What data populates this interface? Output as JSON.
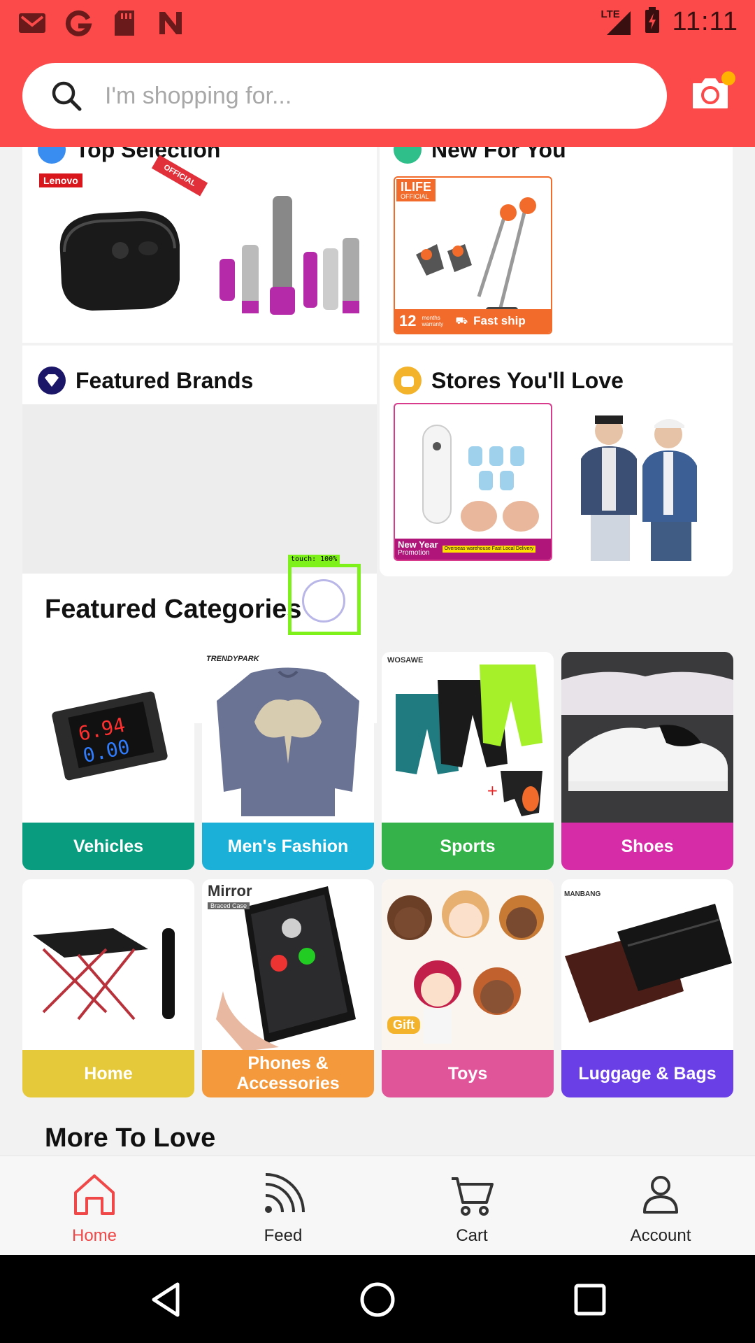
{
  "status_bar": {
    "time": "11:11",
    "network": "LTE",
    "icons": [
      "gmail-icon",
      "g-icon",
      "sd-card-icon",
      "n-icon"
    ]
  },
  "search": {
    "placeholder": "I'm shopping for..."
  },
  "cards": {
    "top_selection": {
      "title": "Top Selection",
      "brand_tag": "Lenovo",
      "ribbon": "OFFICIAL"
    },
    "new_for_you": {
      "title": "New For You",
      "brand": "ILIFE",
      "brand_sub": "OFFICIAL",
      "months": "12",
      "months_label": "months warranty",
      "fast_ship": "Fast ship"
    },
    "featured_brands": {
      "title": "Featured Brands"
    },
    "stores": {
      "title": "Stores You'll Love",
      "promo_line1": "New Year",
      "promo_line2": "Promotion",
      "promo_small": "Overseas warehouse Fast Local Delivery"
    }
  },
  "sections": {
    "featured_categories": "Featured Categories",
    "more_to_love": "More To Love"
  },
  "touch": {
    "label": "touch: 100%"
  },
  "categories": [
    {
      "label": "Vehicles",
      "color": "#0a9c7e"
    },
    {
      "label": "Men's Fashion",
      "color": "#1ab0d8",
      "brand": "TRENDYPARK"
    },
    {
      "label": "Sports",
      "color": "#35b34a",
      "brand": "WOSAWE"
    },
    {
      "label": "Shoes",
      "color": "#d62ca8"
    },
    {
      "label": "Home",
      "color": "#e5c93a"
    },
    {
      "label": "Phones & Accessories",
      "color": "#f59a3c",
      "brand": "Mirror",
      "brand_sub": "Braced Case"
    },
    {
      "label": "Toys",
      "color": "#e0559a",
      "tag": "Gift"
    },
    {
      "label": "Luggage & Bags",
      "color": "#6b3fe6",
      "brand": "MANBANG"
    }
  ],
  "bottom_nav": [
    {
      "label": "Home",
      "icon": "home-icon",
      "active": true
    },
    {
      "label": "Feed",
      "icon": "feed-icon",
      "active": false
    },
    {
      "label": "Cart",
      "icon": "cart-icon",
      "active": false
    },
    {
      "label": "Account",
      "icon": "account-icon",
      "active": false
    }
  ],
  "colors": {
    "brand": "#fc4a4a",
    "active_nav": "#f04848"
  }
}
